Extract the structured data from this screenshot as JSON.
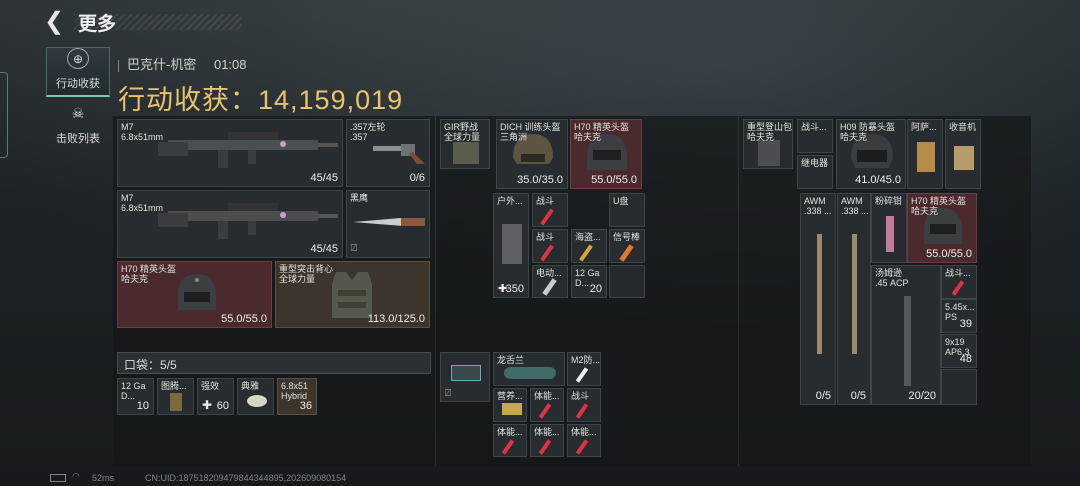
{
  "header": {
    "back_glyph": "❮",
    "title": "更多"
  },
  "sidebar": [
    {
      "label": "行动收获",
      "icon": "crosshair-icon",
      "active": true
    },
    {
      "label": "击败列表",
      "icon": "skull-icon",
      "active": false
    }
  ],
  "info": {
    "map": "巴克什-机密",
    "time": "01:08"
  },
  "gain": {
    "label": "行动收获：",
    "value": "14,159,019"
  },
  "weapons": [
    {
      "name": "M7",
      "sub": "6.8x51mm",
      "count": "45/45"
    },
    {
      "name": ".357左轮",
      "sub": ".357",
      "count": "0/6"
    },
    {
      "name": "M7",
      "sub": "6.8x51mm",
      "count": "45/45"
    },
    {
      "name": "黑鹰",
      "sub": "",
      "count": ""
    }
  ],
  "armor": [
    {
      "name": "H70 精英头盔\n哈夫克",
      "durability": "55.0/55.0"
    },
    {
      "name": "重型突击背心\n全球力量",
      "durability": "113.0/125.0"
    }
  ],
  "pocket": {
    "label": "口袋：",
    "value": "5/5"
  },
  "pocket_items": [
    {
      "name": "12 Ga\nD...",
      "count": "10"
    },
    {
      "name": "图腾...",
      "count": ""
    },
    {
      "name": "强效",
      "count": "60"
    },
    {
      "name": "典雅",
      "count": ""
    },
    {
      "name": "6.8x51\nHybrid",
      "count": "36"
    }
  ],
  "mid_top": [
    {
      "name": "GIR野战\n全球力量",
      "count": ""
    },
    {
      "name": "DICH 训练头盔\n三角洲",
      "count": "35.0/35.0"
    },
    {
      "name": "H70 精英头盔\n哈夫克",
      "count": "55.0/55.0"
    }
  ],
  "mid_grid": [
    {
      "name": "户外...",
      "count": "350"
    },
    {
      "name": "战斗",
      "count": ""
    },
    {
      "name": "U盘",
      "count": ""
    },
    {
      "name": "战斗",
      "count": ""
    },
    {
      "name": "海盗...",
      "count": ""
    },
    {
      "name": "信号棒",
      "count": ""
    },
    {
      "name": "电动...",
      "count": ""
    },
    {
      "name": "12 Ga\nD...",
      "count": "20"
    }
  ],
  "mid_bottom": [
    {
      "name": "龙舌兰",
      "count": ""
    },
    {
      "name": "M2防...",
      "count": ""
    },
    {
      "name": "营养...",
      "count": ""
    },
    {
      "name": "体能...",
      "count": ""
    },
    {
      "name": "战斗",
      "count": ""
    },
    {
      "name": "体能...",
      "count": ""
    },
    {
      "name": "体能...",
      "count": ""
    },
    {
      "name": "体能...",
      "count": ""
    }
  ],
  "right_top": [
    {
      "name": "重型登山包\n哈夫克",
      "count": ""
    },
    {
      "name": "战斗...",
      "count": ""
    },
    {
      "name": "H09 防暴头盔\n哈夫克",
      "count": "41.0/45.0"
    },
    {
      "name": "阿萨...",
      "count": ""
    },
    {
      "name": "收音机",
      "count": ""
    },
    {
      "name": "继电器",
      "count": ""
    }
  ],
  "right_grid": [
    {
      "name": "AWM\n.338 ...",
      "count": "0/5"
    },
    {
      "name": "AWM\n.338 ...",
      "count": "0/5"
    },
    {
      "name": "粉碎钳",
      "count": ""
    },
    {
      "name": "H70 精英头盔\n哈夫克",
      "count": "55.0/55.0"
    },
    {
      "name": "汤姆逊\n.45 ACP",
      "count": "20/20"
    },
    {
      "name": "战斗...",
      "count": ""
    },
    {
      "name": "5.45x...\nPS",
      "count": "39"
    },
    {
      "name": "9x19\nAP6.3",
      "count": "48"
    }
  ],
  "status": {
    "ping": "52ms",
    "uid": "CN:UID:18751820947984434489​5,202609080154"
  }
}
